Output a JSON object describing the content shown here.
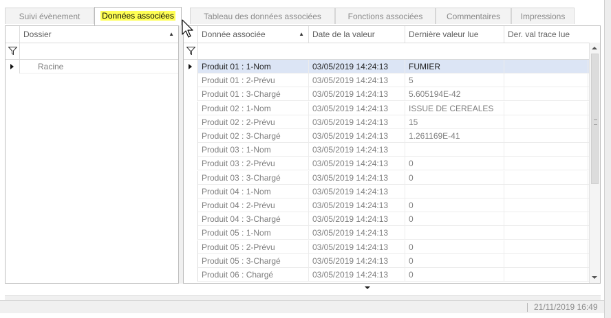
{
  "tabs": [
    {
      "label": "Suivi évènement",
      "active": false
    },
    {
      "label": "Données associées",
      "active": true
    },
    {
      "label": "Tableau des données associées",
      "active": false
    },
    {
      "label": "Fonctions associées",
      "active": false
    },
    {
      "label": "Commentaires",
      "active": false
    },
    {
      "label": "Impressions",
      "active": false
    }
  ],
  "left_grid": {
    "column_header": "Dossier",
    "rows": [
      {
        "label": "Racine"
      }
    ]
  },
  "right_grid": {
    "columns": [
      "Donnée associée",
      "Date de la valeur",
      "Dernière valeur lue",
      "Der. val trace lue"
    ],
    "rows": [
      {
        "name": "Produit 01 : 1-Nom",
        "date": "03/05/2019 14:24:13",
        "value": "FUMIER",
        "trace": ""
      },
      {
        "name": "Produit 01 : 2-Prévu",
        "date": "03/05/2019 14:24:13",
        "value": "5",
        "trace": ""
      },
      {
        "name": "Produit 01 : 3-Chargé",
        "date": "03/05/2019 14:24:13",
        "value": "5.605194E-42",
        "trace": ""
      },
      {
        "name": "Produit 02 : 1-Nom",
        "date": "03/05/2019 14:24:13",
        "value": "ISSUE DE CEREALES",
        "trace": ""
      },
      {
        "name": "Produit 02 : 2-Prévu",
        "date": "03/05/2019 14:24:13",
        "value": "15",
        "trace": ""
      },
      {
        "name": "Produit 02 : 3-Chargé",
        "date": "03/05/2019 14:24:13",
        "value": "1.261169E-41",
        "trace": ""
      },
      {
        "name": "Produit 03 : 1-Nom",
        "date": "03/05/2019 14:24:13",
        "value": "",
        "trace": ""
      },
      {
        "name": "Produit 03 : 2-Prévu",
        "date": "03/05/2019 14:24:13",
        "value": "0",
        "trace": ""
      },
      {
        "name": "Produit 03 : 3-Chargé",
        "date": "03/05/2019 14:24:13",
        "value": "0",
        "trace": ""
      },
      {
        "name": "Produit 04 : 1-Nom",
        "date": "03/05/2019 14:24:13",
        "value": "",
        "trace": ""
      },
      {
        "name": "Produit 04 : 2-Prévu",
        "date": "03/05/2019 14:24:13",
        "value": "0",
        "trace": ""
      },
      {
        "name": "Produit 04 : 3-Chargé",
        "date": "03/05/2019 14:24:13",
        "value": "0",
        "trace": ""
      },
      {
        "name": "Produit 05 : 1-Nom",
        "date": "03/05/2019 14:24:13",
        "value": "",
        "trace": ""
      },
      {
        "name": "Produit 05 : 2-Prévu",
        "date": "03/05/2019 14:24:13",
        "value": "0",
        "trace": ""
      },
      {
        "name": "Produit 05 : 3-Chargé",
        "date": "03/05/2019 14:24:13",
        "value": "0",
        "trace": ""
      },
      {
        "name": "Produit 06 : Chargé",
        "date": "03/05/2019 14:24:13",
        "value": "0",
        "trace": ""
      }
    ]
  },
  "status": {
    "datetime": "21/11/2019 16:49"
  },
  "icons": {
    "filter": "filter-funnel-icon",
    "cursor": "mouse-pointer-icon",
    "sort": "sort-up-icon"
  },
  "colors": {
    "active_tab_highlight": "#ffff55",
    "selected_row": "#dce5f5"
  }
}
